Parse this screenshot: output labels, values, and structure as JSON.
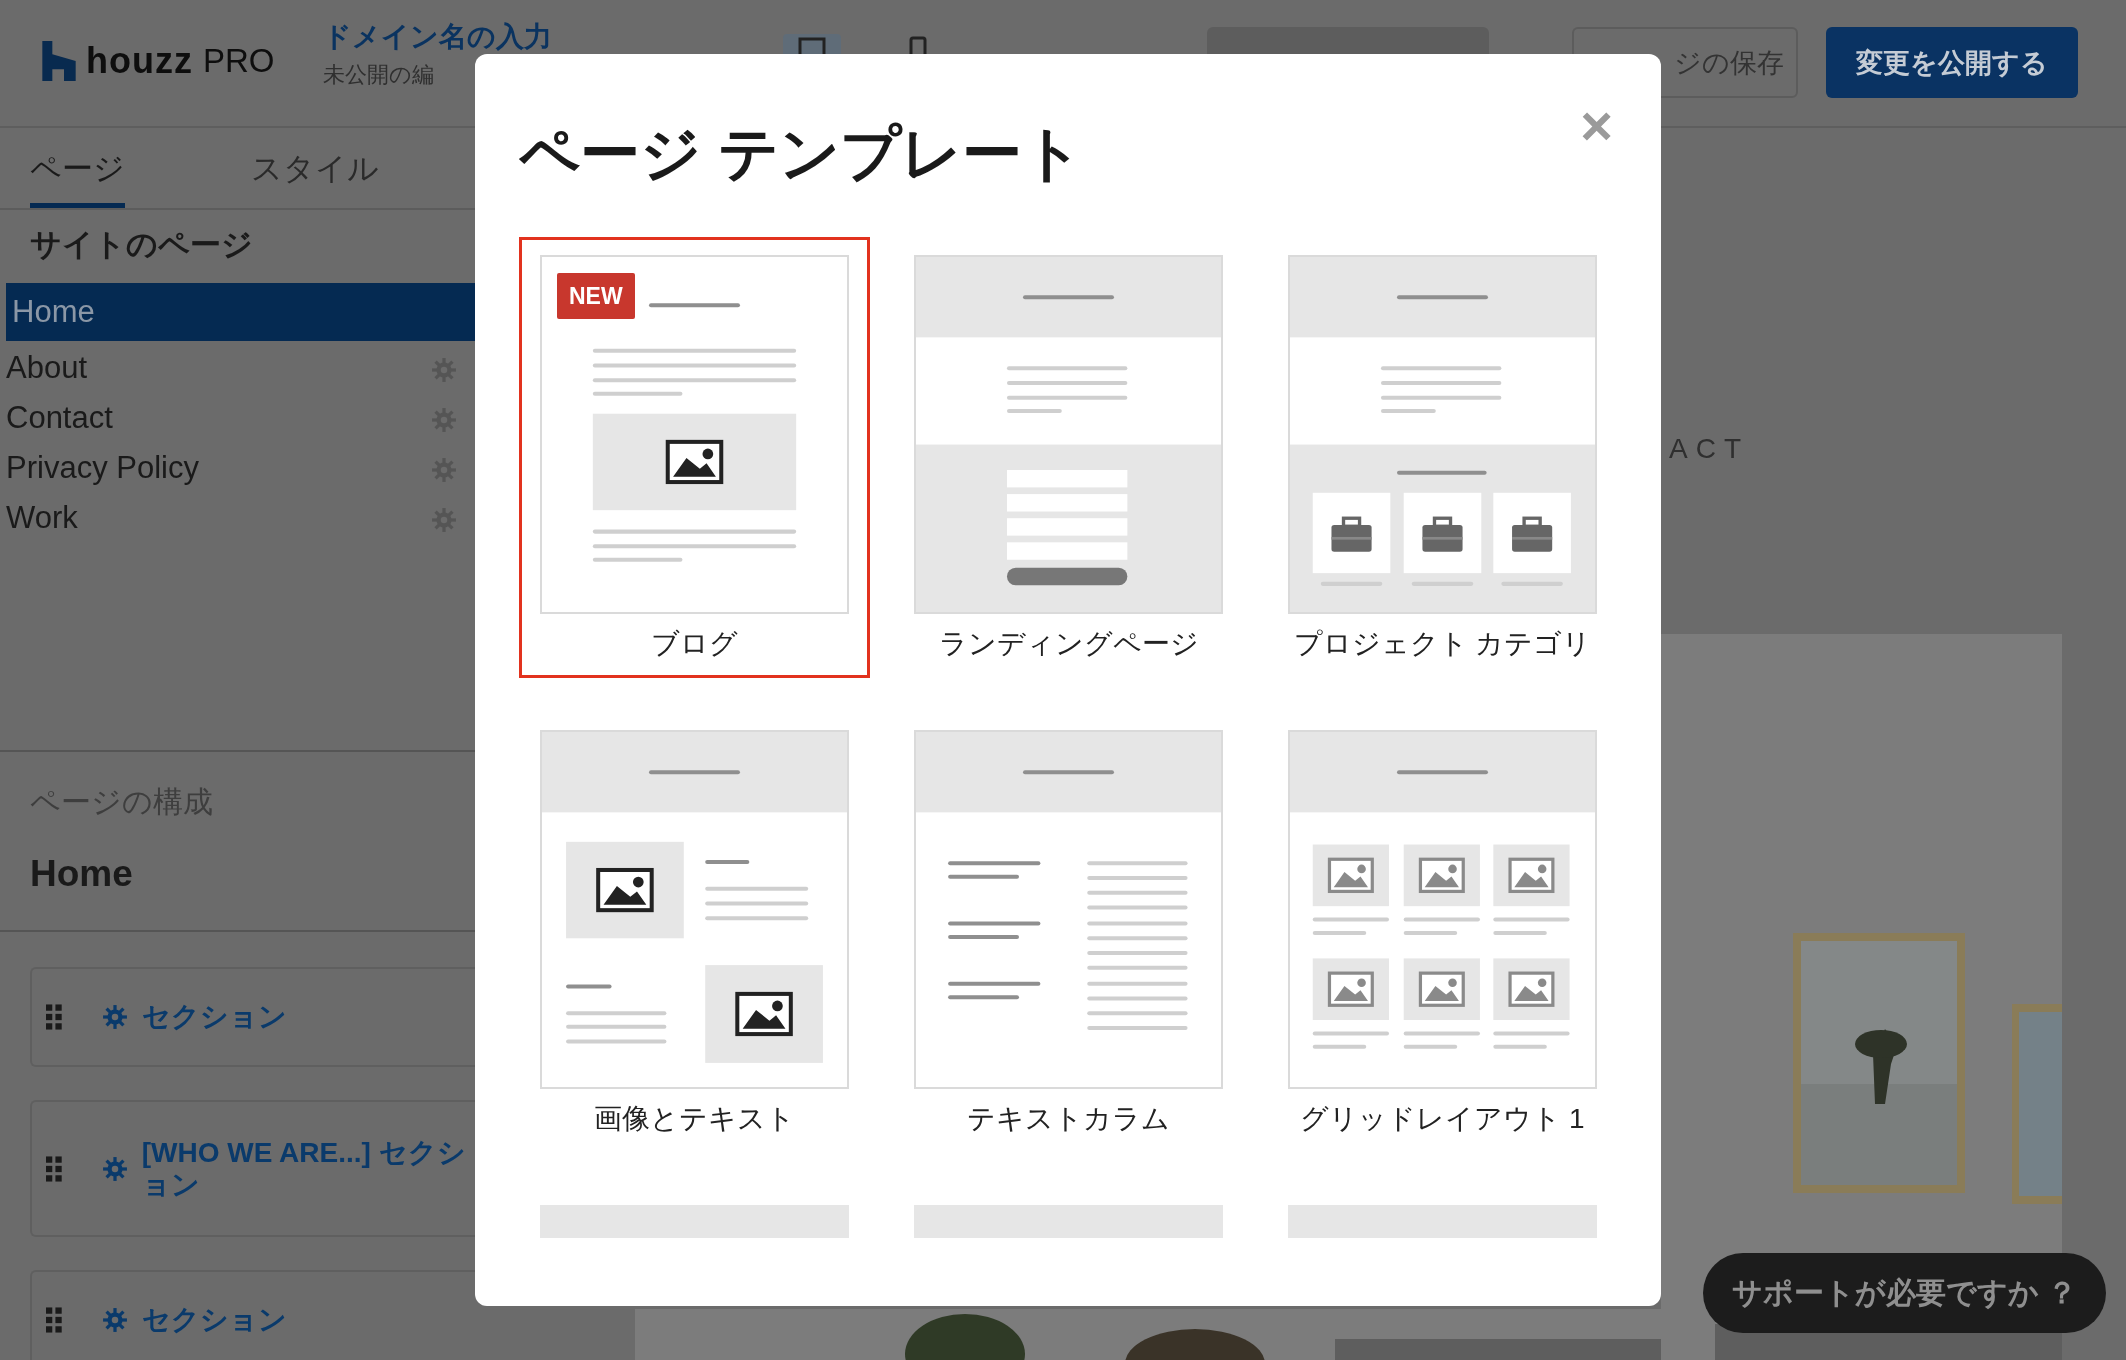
{
  "header": {
    "logo": {
      "brand": "houzz",
      "suffix": "PRO"
    },
    "site_title": "ドメイン名の入力",
    "site_status": "未公開の編",
    "devices": [
      {
        "kind": "desktop",
        "selected": true
      },
      {
        "kind": "mobile",
        "selected": false
      }
    ],
    "save_button": "ジの保存",
    "publish_button": "変更を公開する"
  },
  "sidebar": {
    "tabs": [
      {
        "label": "ページ",
        "selected": true
      },
      {
        "label": "スタイル",
        "selected": false
      }
    ],
    "pages_heading": "サイトのページ",
    "pages": [
      {
        "label": "Home",
        "selected": true
      },
      {
        "label": "About",
        "selected": false
      },
      {
        "label": "Contact",
        "selected": false
      },
      {
        "label": "Privacy Policy",
        "selected": false
      },
      {
        "label": "Work",
        "selected": false
      }
    ],
    "structure_heading": "ページの構成",
    "structure_title": "Home",
    "sections": [
      {
        "label": "セクション",
        "kind": "single"
      },
      {
        "label": "[WHO WE ARE...] セクション",
        "kind": "nested"
      },
      {
        "label": "セクション",
        "kind": "single"
      }
    ]
  },
  "preview": {
    "nav_text": "ACT",
    "support_button": "サポートが必要ですか ？"
  },
  "modal": {
    "title": "ページ テンプレート",
    "close": "×",
    "templates": [
      {
        "label": "ブログ",
        "kind": "blog",
        "selected": true,
        "badge": "NEW"
      },
      {
        "label": "ランディングページ",
        "kind": "landing",
        "selected": false
      },
      {
        "label": "プロジェクト カテゴリ",
        "kind": "project",
        "selected": false
      },
      {
        "label": "画像とテキスト",
        "kind": "image_text",
        "selected": false
      },
      {
        "label": "テキストカラム",
        "kind": "text_columns",
        "selected": false
      },
      {
        "label": "グリッドレイアウト 1",
        "kind": "grid",
        "selected": false
      },
      {
        "kind": "partial",
        "selected": false
      },
      {
        "kind": "partial",
        "selected": false
      },
      {
        "kind": "partial",
        "selected": false
      }
    ]
  }
}
